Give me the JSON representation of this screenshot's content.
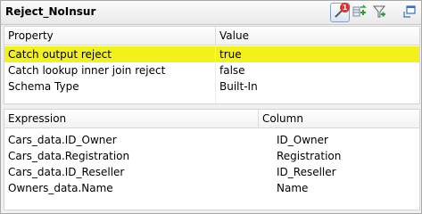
{
  "window": {
    "title": "Reject_NoInsur",
    "error_badge": "1"
  },
  "toolbar": {
    "icons": [
      "error-filter-icon",
      "add-row-icon",
      "filter-icon",
      "expand-icon"
    ]
  },
  "properties": {
    "columns": [
      "Property",
      "Value"
    ],
    "rows": [
      {
        "property": "Catch output reject",
        "value": "true",
        "selected": true
      },
      {
        "property": "Catch lookup inner join reject",
        "value": "false",
        "selected": false
      },
      {
        "property": "Schema Type",
        "value": "Built-In",
        "selected": false
      }
    ]
  },
  "expressions": {
    "columns": [
      "Expression",
      "Column"
    ],
    "rows": [
      {
        "expression": "Cars_data.ID_Owner",
        "column": "ID_Owner"
      },
      {
        "expression": "Cars_data.Registration",
        "column": "Registration"
      },
      {
        "expression": "Cars_data.ID_Reseller",
        "column": "ID_Reseller"
      },
      {
        "expression": "Owners_data.Name",
        "column": "Name"
      }
    ]
  },
  "colors": {
    "selected_row": "#f2f21a",
    "badge": "#e8302a",
    "add_green": "#2e9e3a"
  }
}
